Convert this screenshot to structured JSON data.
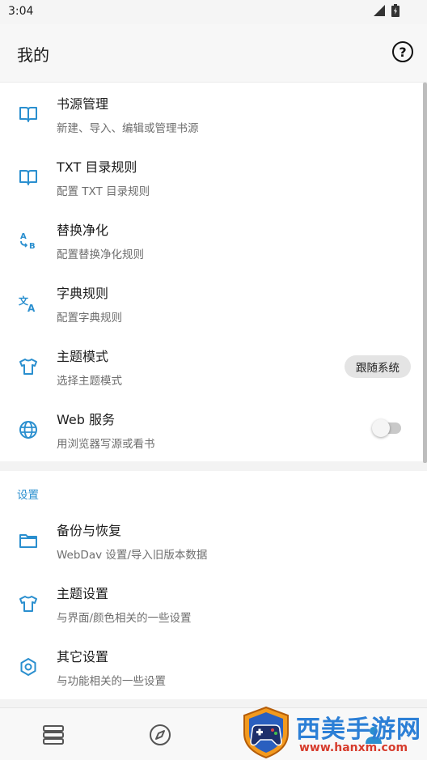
{
  "status_bar": {
    "time": "3:04"
  },
  "header": {
    "title": "我的",
    "help_icon_glyph": "?"
  },
  "colors": {
    "accent": "#2a8fcf",
    "icon_blue": "#2a8fcf"
  },
  "main_items": [
    {
      "icon": "book-open-icon",
      "title": "书源管理",
      "subtitle": "新建、导入、编辑或管理书源"
    },
    {
      "icon": "book-open-icon",
      "title": "TXT 目录规则",
      "subtitle": "配置 TXT 目录规则"
    },
    {
      "icon": "find-replace-icon",
      "title": "替换净化",
      "subtitle": "配置替换净化规则"
    },
    {
      "icon": "translate-icon",
      "title": "字典规则",
      "subtitle": "配置字典规则"
    },
    {
      "icon": "tshirt-icon",
      "title": "主题模式",
      "subtitle": "选择主题模式",
      "chip": "跟随系统"
    },
    {
      "icon": "globe-icon",
      "title": "Web 服务",
      "subtitle": "用浏览器写源或看书",
      "toggle_on": false
    }
  ],
  "settings": {
    "header": "设置",
    "items": [
      {
        "icon": "folder-icon",
        "title": "备份与恢复",
        "subtitle": "WebDav 设置/导入旧版本数据"
      },
      {
        "icon": "tshirt-icon",
        "title": "主题设置",
        "subtitle": "与界面/颜色相关的一些设置"
      },
      {
        "icon": "hexagon-settings-icon",
        "title": "其它设置",
        "subtitle": "与功能相关的一些设置"
      }
    ]
  },
  "bottom_nav": [
    "bookshelf-icon",
    "compass-icon",
    "rss-icon",
    "person-icon"
  ],
  "watermark": {
    "text": "西美手游网",
    "url": "www.hanxm.com"
  }
}
